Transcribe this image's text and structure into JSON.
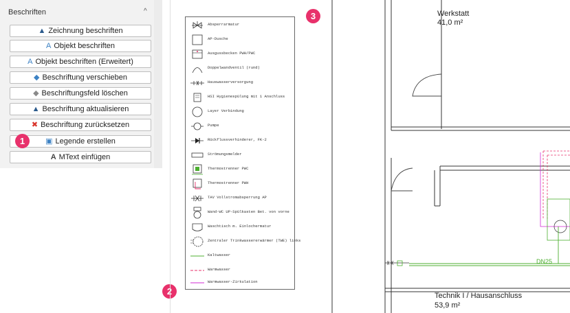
{
  "panel": {
    "title": "Beschriften",
    "collapse_glyph": "^",
    "buttons": [
      {
        "label": "Zeichnung beschriften",
        "icon": "label-drawing-icon",
        "glyph": "▲",
        "color": "#2b5a8c"
      },
      {
        "label": "Objekt beschriften",
        "icon": "label-object-icon",
        "glyph": "A",
        "color": "#3d82c4"
      },
      {
        "label": "Objekt beschriften (Erweitert)",
        "icon": "label-object-extended-icon",
        "glyph": "A",
        "color": "#3d82c4"
      },
      {
        "label": "Beschriftung verschieben",
        "icon": "move-label-icon",
        "glyph": "◆",
        "color": "#3d82c4"
      },
      {
        "label": "Beschriftungsfeld löschen",
        "icon": "eraser-icon",
        "glyph": "◆",
        "color": "#8a8a8a"
      },
      {
        "label": "Beschriftung aktualisieren",
        "icon": "update-label-icon",
        "glyph": "▲",
        "color": "#2b5a8c"
      },
      {
        "label": "Beschriftung zurücksetzen",
        "icon": "reset-label-icon",
        "glyph": "✖",
        "color": "#d9342b"
      },
      {
        "label": "Legende erstellen",
        "icon": "legend-icon",
        "glyph": "▣",
        "color": "#3d82c4"
      },
      {
        "label": "MText einfügen",
        "icon": "mtext-icon",
        "glyph": "A",
        "color": "#444444"
      }
    ]
  },
  "markers": [
    "1",
    "2",
    "3"
  ],
  "legend": {
    "items": [
      "Absperrarmatur",
      "AP-Dusche",
      "Ausgussbecken PWH/PWC",
      "Doppelwandventil (rund)",
      "Hauswasserversorgung",
      "HSI Hygienespülung mit 1 Anschluss",
      "Layer Verbindung",
      "Pumpe",
      "Rückflussverhinderer, FK-2",
      "Strömungsmelder",
      "Thermostrenner PWC",
      "Thermostrenner PWH",
      "TAV Vollstromabsperrung AP",
      "Wand-WC UP-Spülkasten Bet. von vorne",
      "Waschtisch m. Einlochermatur",
      "Zentraler Trinkwassererwärmer (TWE) links",
      "Kaltwasser",
      "Warmwasser",
      "Warmwasser-Zirkulation"
    ]
  },
  "plan": {
    "room1_name": "Werkstatt",
    "room1_area": "41,0 m²",
    "room2_name": "Technik I / Hausanschluss",
    "room2_area": "53,9 m²",
    "pipe_label": "DN25"
  },
  "colors": {
    "marker": "#e8316b",
    "cold_water": "#4caf2f",
    "warm_water": "#e8316b",
    "circulation": "#d12ad4"
  }
}
